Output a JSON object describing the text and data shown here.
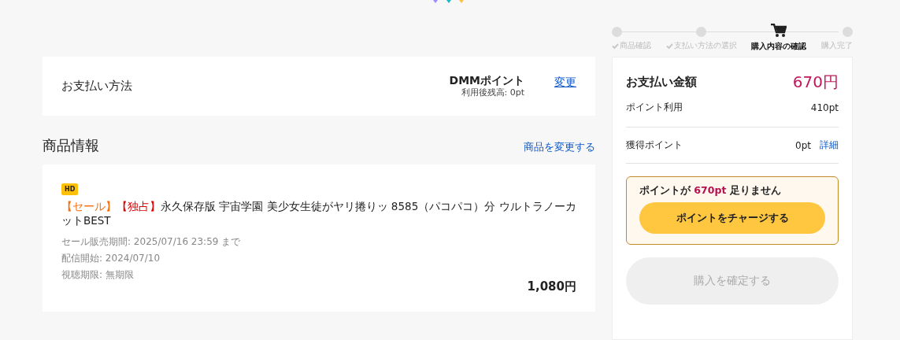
{
  "steps": [
    {
      "label": "商品確認",
      "done": true,
      "selected": false
    },
    {
      "label": "支払い方法の選択",
      "done": true,
      "selected": false
    },
    {
      "label": "購入内容の確認",
      "done": false,
      "selected": true
    },
    {
      "label": "購入完了",
      "done": false,
      "selected": false
    }
  ],
  "payment_method": {
    "heading": "お支払い方法",
    "method": "DMMポイント",
    "balance": "利用後残高: 0pt",
    "change_link": "変更"
  },
  "product_section": {
    "heading": "商品情報",
    "change_link": "商品を変更する"
  },
  "product": {
    "badge": "HD",
    "tags": [
      {
        "text": "【セール】",
        "color": "#ff6a00"
      },
      {
        "text": "【独占】",
        "color": "#e00000"
      }
    ],
    "title": "永久保存版 宇宙学園 美少女生徒がヤリ捲りッ 8585（パコパコ）分 ウルトラノーカットBEST",
    "details": [
      "セール販売期間: 2025/07/16 23:59 まで",
      "配信開始: 2024/07/10",
      "視聴期限: 無期限"
    ],
    "price": "1,080円"
  },
  "summary": {
    "total_label": "お支払い金額",
    "total": "670円",
    "rows": [
      {
        "label": "ポイント利用",
        "value": "410pt"
      },
      {
        "label": "獲得ポイント",
        "value": "0pt",
        "link": "詳細"
      }
    ],
    "shortage": {
      "before": "ポイントが ",
      "amount": "670pt",
      "after": " 足りません",
      "button": "ポイントをチャージする"
    },
    "confirm": {
      "label": "購入を確定する",
      "disabled": true
    }
  }
}
